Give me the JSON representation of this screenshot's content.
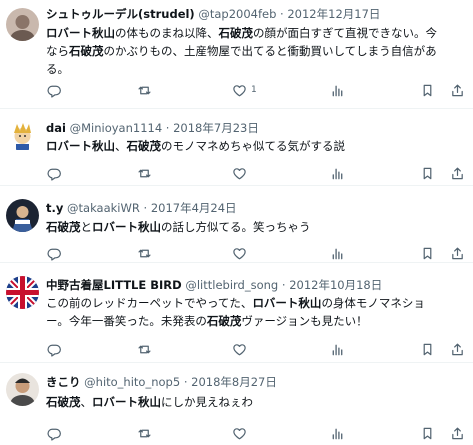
{
  "tweets": [
    {
      "name": "シュトゥルーデル(strudel)",
      "handle": "@tap2004feb",
      "separator": "·",
      "date": "2012年12月17日",
      "body_segments": [
        {
          "text": "ロバート秋山",
          "bold": true
        },
        {
          "text": "の体ものまね以降、",
          "bold": false
        },
        {
          "text": "石破茂",
          "bold": true
        },
        {
          "text": "の顔が面白すぎて直視できない。今",
          "bold": false
        },
        {
          "text": "\n",
          "bold": false
        },
        {
          "text": "なら",
          "bold": false
        },
        {
          "text": "石破茂",
          "bold": true
        },
        {
          "text": "のかぶりもの、土産物屋で出てると衝動買いしてしまう自信があ",
          "bold": false
        },
        {
          "text": "\n",
          "bold": false
        },
        {
          "text": "る。",
          "bold": false
        }
      ],
      "like_count": "1"
    },
    {
      "name": "dai",
      "handle": "@Minioyan1114",
      "separator": "·",
      "date": "2018年7月23日",
      "body_segments": [
        {
          "text": "ロバート秋山",
          "bold": true
        },
        {
          "text": "、",
          "bold": false
        },
        {
          "text": "石破茂",
          "bold": true
        },
        {
          "text": "のモノマネめちゃ似てる気がする説",
          "bold": false
        }
      ],
      "like_count": ""
    },
    {
      "name": "t.y",
      "handle": "@takaakiWR",
      "separator": "·",
      "date": "2017年4月24日",
      "body_segments": [
        {
          "text": "石破茂",
          "bold": true
        },
        {
          "text": "と",
          "bold": false
        },
        {
          "text": "ロバート秋山",
          "bold": true
        },
        {
          "text": "の話し方似てる。笑っちゃう",
          "bold": false
        }
      ],
      "like_count": ""
    },
    {
      "name": "中野古着屋LITTLE BIRD",
      "handle": "@littlebird_song",
      "separator": "·",
      "date": "2012年10月18日",
      "body_segments": [
        {
          "text": "この前のレッドカーペットでやってた、",
          "bold": false
        },
        {
          "text": "ロバート秋山",
          "bold": true
        },
        {
          "text": "の身体モノマネショ",
          "bold": false
        },
        {
          "text": "\n",
          "bold": false
        },
        {
          "text": "ー。今年一番笑った。未発表の",
          "bold": false
        },
        {
          "text": "石破茂",
          "bold": true
        },
        {
          "text": "ヴァージョンも見たい！",
          "bold": false
        }
      ],
      "like_count": ""
    },
    {
      "name": "きこり",
      "handle": "@hito_hito_nop5",
      "separator": "·",
      "date": "2018年8月27日",
      "body_segments": [
        {
          "text": "石破茂",
          "bold": true
        },
        {
          "text": "、",
          "bold": false
        },
        {
          "text": "ロバート秋山",
          "bold": true
        },
        {
          "text": "にしか見えねぇわ",
          "bold": false
        }
      ],
      "like_count": ""
    }
  ],
  "icons": {
    "reply": "reply-icon",
    "retweet": "retweet-icon",
    "like": "heart-icon",
    "views": "views-icon",
    "bookmark": "bookmark-icon",
    "share": "share-icon"
  },
  "colors": {
    "text": "#0f1419",
    "secondary": "#536471",
    "divider": "#eff3f4"
  }
}
